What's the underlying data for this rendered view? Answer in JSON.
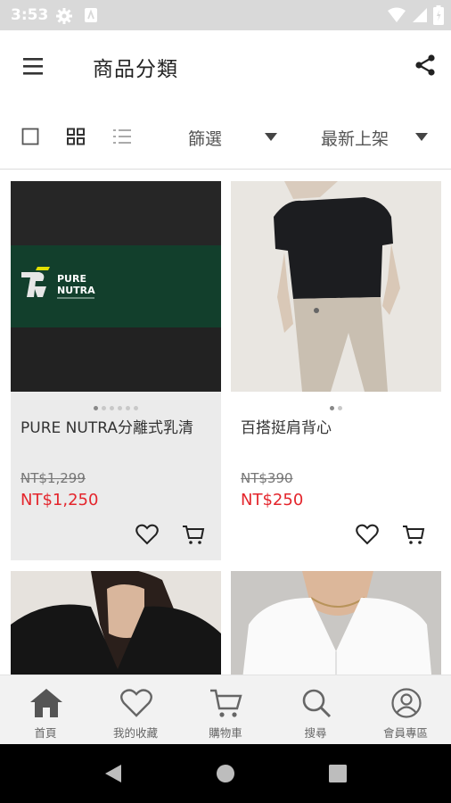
{
  "status_bar": {
    "time": "3:53"
  },
  "app_bar": {
    "title": "商品分類"
  },
  "toolbar": {
    "filter_label": "篩選",
    "sort_label": "最新上架"
  },
  "products": [
    {
      "name": "PURE NUTRA分離式乳清",
      "original_price": "NT$1,299",
      "price": "NT$1,250",
      "image_text": [
        "PURE",
        "NUTRA"
      ]
    },
    {
      "name": "百搭挺肩背心",
      "original_price": "NT$390",
      "price": "NT$250"
    },
    {
      "name": "",
      "original_price": "",
      "price": ""
    },
    {
      "name": "",
      "original_price": "",
      "price": ""
    }
  ],
  "bottom_nav": [
    {
      "label": "首頁",
      "icon": "home-icon"
    },
    {
      "label": "我的收藏",
      "icon": "heart-icon"
    },
    {
      "label": "購物車",
      "icon": "cart-icon"
    },
    {
      "label": "搜尋",
      "icon": "search-icon"
    },
    {
      "label": "會員專區",
      "icon": "user-icon"
    }
  ],
  "colors": {
    "price_red": "#e4252c",
    "status_bar": "#d9d9d9",
    "card_bg": "#ebebeb",
    "nav_bg": "#f2f2f2"
  }
}
